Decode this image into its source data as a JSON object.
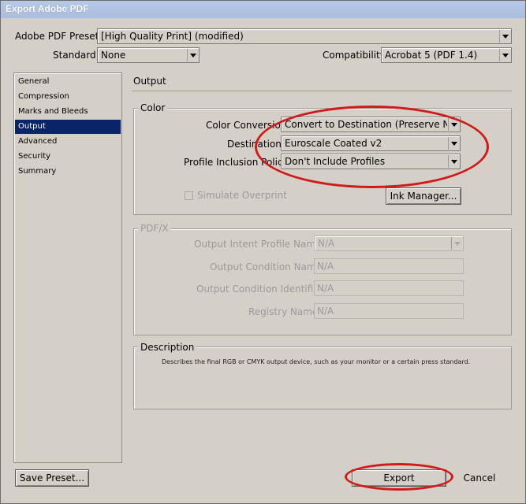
{
  "window": {
    "title": "Export Adobe PDF"
  },
  "preset": {
    "label": "Adobe PDF Preset:",
    "value": "[High Quality Print] (modified)"
  },
  "standard": {
    "label": "Standard:",
    "value": "None"
  },
  "compatibility": {
    "label": "Compatibility:",
    "value": "Acrobat 5 (PDF 1.4)"
  },
  "sidebar": {
    "items": [
      {
        "label": "General"
      },
      {
        "label": "Compression"
      },
      {
        "label": "Marks and Bleeds"
      },
      {
        "label": "Output"
      },
      {
        "label": "Advanced"
      },
      {
        "label": "Security"
      },
      {
        "label": "Summary"
      }
    ],
    "selected": "Output"
  },
  "section": {
    "title": "Output"
  },
  "color": {
    "group_title": "Color",
    "conversion_label": "Color Conversion:",
    "conversion_value": "Convert to Destination (Preserve Numb",
    "destination_label": "Destination:",
    "destination_value": "Euroscale Coated v2",
    "profile_label": "Profile Inclusion Policy:",
    "profile_value": "Don't Include Profiles",
    "simulate_label": "Simulate Overprint",
    "ink_manager_label": "Ink Manager..."
  },
  "pdfx": {
    "group_title": "PDF/X",
    "intent_label": "Output Intent Profile Name:",
    "intent_value": "N/A",
    "condition_name_label": "Output Condition Name:",
    "condition_name_value": "N/A",
    "condition_id_label": "Output Condition Identifier:",
    "condition_id_value": "N/A",
    "registry_label": "Registry Name:",
    "registry_value": "N/A"
  },
  "description": {
    "group_title": "Description",
    "text": "Describes the final RGB or CMYK output device, such as your monitor or a certain press standard."
  },
  "buttons": {
    "save_preset": "Save Preset...",
    "export": "Export",
    "cancel": "Cancel"
  },
  "colors": {
    "highlight_ellipse": "#d11a1a",
    "selected_nav": "#0a246a"
  }
}
